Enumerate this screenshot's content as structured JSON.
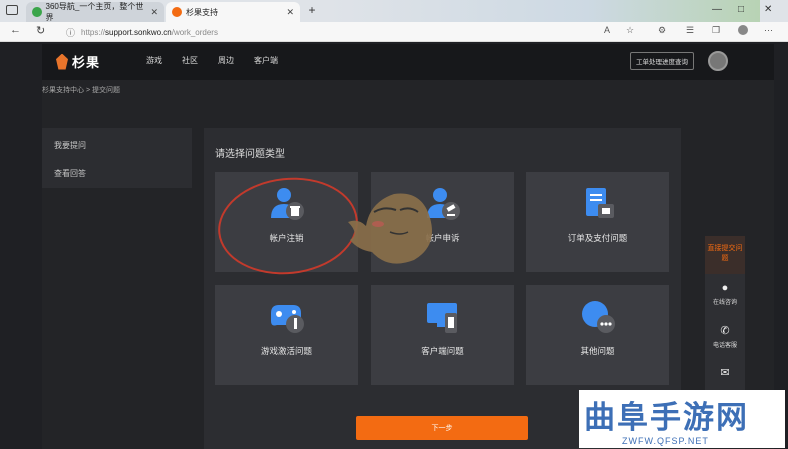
{
  "browser": {
    "tabs": [
      {
        "title": "360导航_一个主页，整个世界",
        "active": false
      },
      {
        "title": "杉果支持",
        "active": true
      }
    ],
    "new_tab": "+",
    "window_controls": [
      "—",
      "□",
      "✕"
    ],
    "url_scheme": "https://",
    "url_host": "support.sonkwo.cn",
    "url_path": "/work_orders"
  },
  "site": {
    "logo_text": "杉果",
    "nav": [
      "游戏",
      "社区",
      "周边",
      "客户端"
    ],
    "ticket_button": "工单处理进度查询",
    "breadcrumb": "杉果支持中心 > 提交问题",
    "brand_color": "#f36b12"
  },
  "sidebar": {
    "items": [
      "我要提问",
      "查看回答"
    ]
  },
  "main": {
    "title": "请选择问题类型",
    "categories": [
      {
        "label": "帐户注销",
        "icon": "user-trash-icon"
      },
      {
        "label": "帐户申诉",
        "icon": "user-gavel-icon"
      },
      {
        "label": "订单及支付问题",
        "icon": "receipt-wallet-icon"
      },
      {
        "label": "游戏激活问题",
        "icon": "gamepad-key-icon"
      },
      {
        "label": "客户端问题",
        "icon": "monitor-phone-icon"
      },
      {
        "label": "其他问题",
        "icon": "chat-bubble-icon"
      }
    ],
    "next_button": "下一步"
  },
  "float_bar": {
    "hot": "直接提交问题",
    "items": [
      {
        "label": "在线咨询",
        "icon": "qq-icon"
      },
      {
        "label": "电话客服",
        "icon": "phone-icon"
      },
      {
        "label": "",
        "icon": "mail-icon"
      }
    ]
  },
  "watermark": {
    "title": "曲阜手游网",
    "sub": "ZWFW.QFSP.NET"
  }
}
